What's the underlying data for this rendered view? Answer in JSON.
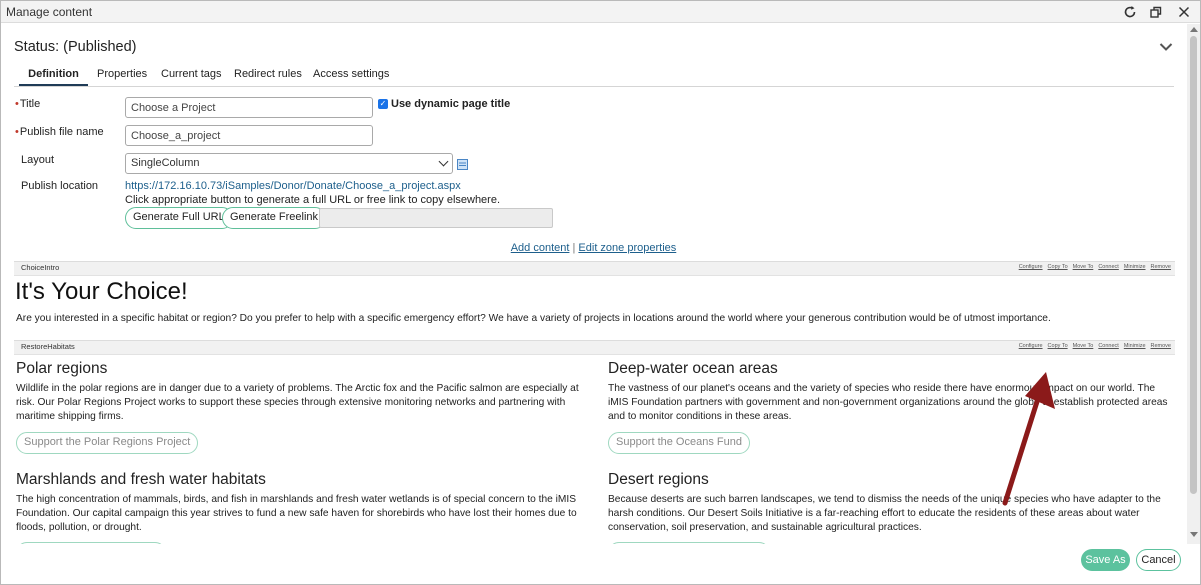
{
  "window": {
    "title": "Manage content"
  },
  "status": "Status: (Published)",
  "tabs": [
    {
      "label": "Definition"
    },
    {
      "label": "Properties"
    },
    {
      "label": "Current tags"
    },
    {
      "label": "Redirect rules"
    },
    {
      "label": "Access settings"
    }
  ],
  "form": {
    "title_label": "Title",
    "title_value": "Choose a Project",
    "dynamic_title_label": "Use dynamic page title",
    "publish_file_label": "Publish file name",
    "publish_file_value": "Choose_a_project",
    "layout_label": "Layout",
    "layout_value": "SingleColumn",
    "publish_location_label": "Publish location",
    "publish_url": "https://172.16.10.73/iSamples/Donor/Donate/Choose_a_project.aspx",
    "publish_hint": "Click appropriate button to generate a full URL or free link to copy elsewhere.",
    "generate_full_url": "Generate Full URL",
    "generate_freelink": "Generate Freelink"
  },
  "zone_links": {
    "add_content": "Add content",
    "separator": "|",
    "edit_zone": "Edit zone properties"
  },
  "zone_actions": [
    "Configure",
    "Copy To",
    "Move To",
    "Connect",
    "Minimize",
    "Remove"
  ],
  "zones": {
    "choice_intro": {
      "name": "ChoiceIntro",
      "heading": "It's Your Choice!",
      "text": "Are you interested in a specific habitat or region? Do you prefer to help with a specific emergency effort? We have a variety of projects in locations around the world where your generous contribution would be of utmost importance."
    },
    "restore_habitats": {
      "name": "RestoreHabitats",
      "items": [
        {
          "title": "Polar regions",
          "text": "Wildlife in the polar regions are in danger due to a variety of problems. The Arctic fox and the Pacific salmon are especially at risk. Our Polar Regions Project works to support these species through extensive monitoring networks and partnering with maritime shipping firms.",
          "button": "Support the Polar Regions Project"
        },
        {
          "title": "Deep-water ocean areas",
          "text": "The vastness of our planet's oceans and the variety of species who reside there have enormous impact on our world. The iMIS Foundation partners with government and non-government organizations around the globe to establish protected areas and to monitor conditions in these areas.",
          "button": "Support the Oceans Fund"
        },
        {
          "title": "Marshlands and fresh water habitats",
          "text": "The high concentration of mammals, birds, and fish in marshlands and fresh water wetlands is of special concern to the iMIS Foundation. Our capital campaign this year strives to fund a new safe haven for shorebirds who have lost their homes due to floods, pollution, or drought."
        },
        {
          "title": "Desert regions",
          "text": "Because deserts are such barren landscapes, we tend to dismiss the needs of the unique species who have adapter to the harsh conditions. Our Desert Soils Initiative is a far-reaching effort to educate the residents of these areas about water conservation, soil preservation, and sustainable agricultural practices."
        }
      ]
    }
  },
  "footer": {
    "save_as": "Save As",
    "cancel": "Cancel"
  },
  "colors": {
    "accent": "#5cc29e",
    "link": "#1d5f8c",
    "annotation_arrow": "#8b1a1a"
  }
}
